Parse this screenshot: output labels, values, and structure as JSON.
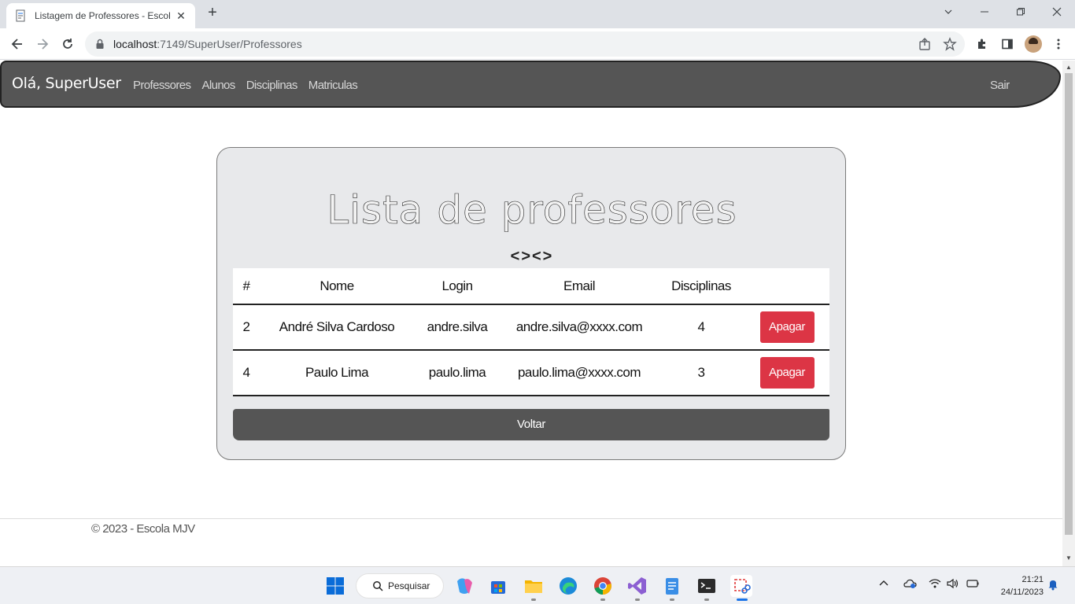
{
  "browser": {
    "tab_title": "Listagem de Professores - Escola MJV",
    "url_host": "localhost",
    "url_path": ":7149/SuperUser/Professores"
  },
  "nav": {
    "brand": "Olá, SuperUser",
    "links": [
      "Professores",
      "Alunos",
      "Disciplinas",
      "Matriculas"
    ],
    "logout": "Sair"
  },
  "main": {
    "title": "Lista de professores",
    "ornament": "<><>",
    "table": {
      "headers": [
        "#",
        "Nome",
        "Login",
        "Email",
        "Disciplinas",
        ""
      ],
      "rows": [
        {
          "id": "2",
          "nome": "André Silva Cardoso",
          "login": "andre.silva",
          "email": "andre.silva@xxxx.com",
          "disciplinas": "4",
          "action": "Apagar"
        },
        {
          "id": "4",
          "nome": "Paulo Lima",
          "login": "paulo.lima",
          "email": "paulo.lima@xxxx.com",
          "disciplinas": "3",
          "action": "Apagar"
        }
      ]
    },
    "back_label": "Voltar"
  },
  "footer": {
    "text": "© 2023 - Escola MJV"
  },
  "taskbar": {
    "search_label": "Pesquisar",
    "time": "21:21",
    "date": "24/11/2023"
  },
  "colors": {
    "navbar": "#555555",
    "danger": "#dc3545",
    "card_bg": "#e8e9eb"
  }
}
